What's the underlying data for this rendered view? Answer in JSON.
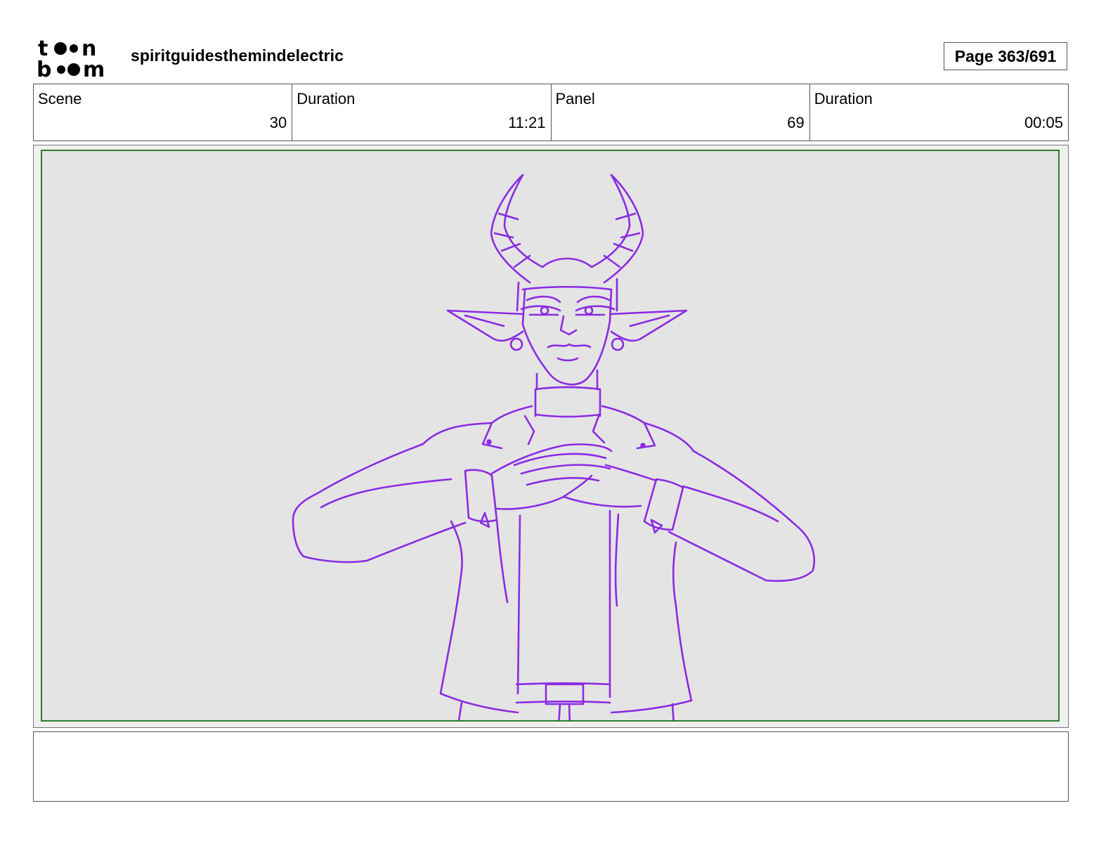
{
  "header": {
    "logo_name": "toon boom",
    "project_title": "spiritguidesthemindelectric",
    "page_label": "Page 363/691"
  },
  "info": {
    "scene_label": "Scene",
    "scene_value": "30",
    "scene_duration_label": "Duration",
    "scene_duration_value": "11:21",
    "panel_label": "Panel",
    "panel_value": "69",
    "panel_duration_label": "Duration",
    "panel_duration_value": "00:05"
  },
  "panel": {
    "sketch_color": "#8a2be2",
    "frame_color": "#2e7d32"
  },
  "notes": {
    "text": ""
  }
}
